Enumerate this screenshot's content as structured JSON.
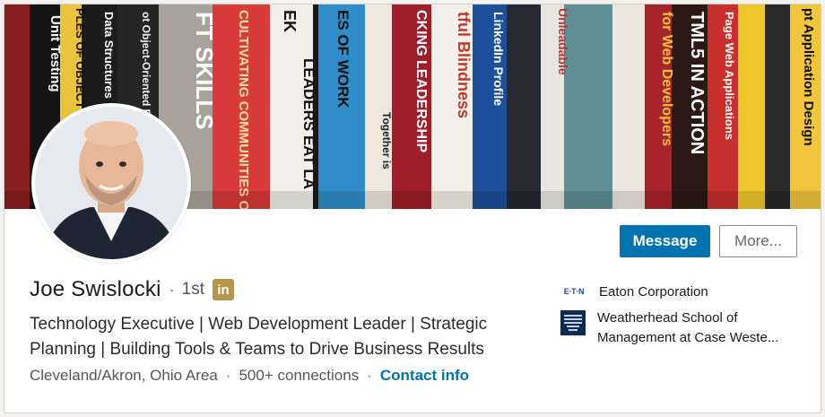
{
  "profile": {
    "name": "Joe Swislocki",
    "degree_separator": "·",
    "degree": "1st",
    "badge_text": "in",
    "headline": "Technology Executive | Web Development Leader | Strategic Planning | Building Tools & Teams to Drive Business Results",
    "location": "Cleveland/Akron, Ohio Area",
    "meta_separator": "·",
    "connections": "500+ connections",
    "contact_label": "Contact info"
  },
  "actions": {
    "message_label": "Message",
    "more_label": "More..."
  },
  "organizations": {
    "company": {
      "name": "Eaton Corporation",
      "logo_text": "E·T·N"
    },
    "school": {
      "name": "Weatherhead School of Management at Case Weste..."
    }
  },
  "banner": {
    "book_spines": [
      "Unit Testing",
      "Data Structures",
      "PLES OF OBJECT",
      "ot Object-Oriented Pr",
      "FT SKILLS",
      "CULTIVATING COMMUNITIES OF PRACTICE",
      "EK",
      "LEADERS EAT LA",
      "ES OF WORK",
      "Together is",
      "CKING LEADERSHIP",
      "tful Blindness",
      "LinkedIn Profile",
      "Unleadable",
      "for Web Developers",
      "TML5 IN ACTION",
      "Page Web Applications",
      "pt Application Design"
    ]
  },
  "colors": {
    "primary_button": "#0073b1",
    "link": "#0073b1",
    "linkedin_badge": "#b5964a"
  }
}
